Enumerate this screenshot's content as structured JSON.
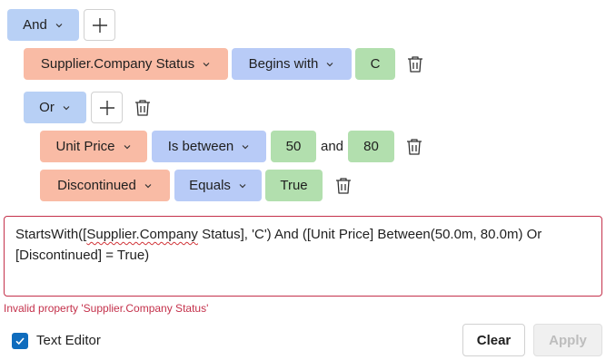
{
  "root_group": {
    "operator_label": "And"
  },
  "condition1": {
    "field": "Supplier.Company Status",
    "operator": "Begins with",
    "value": "C"
  },
  "nested_group": {
    "operator_label": "Or"
  },
  "condition2": {
    "field": "Unit Price",
    "operator": "Is between",
    "value_from": "50",
    "between_text": "and",
    "value_to": "80"
  },
  "condition3": {
    "field": "Discontinued",
    "operator": "Equals",
    "value": "True"
  },
  "editor": {
    "expr_prefix": "StartsWith([",
    "expr_underlined": "Supplier.Company",
    "expr_rest": " Status], 'C') And ([Unit Price] Between(50.0m, 80.0m) Or [Discontinued] = True)",
    "error_message": "Invalid property 'Supplier.Company Status'"
  },
  "footer": {
    "text_editor_label": "Text Editor",
    "text_editor_checked": true,
    "clear_label": "Clear",
    "apply_label": "Apply"
  },
  "colors": {
    "group": "#b8d0f5",
    "field": "#f9bba5",
    "operator": "#b8cbf7",
    "value": "#b2dfae",
    "error": "#c4314b",
    "accent": "#0f6cbd"
  }
}
